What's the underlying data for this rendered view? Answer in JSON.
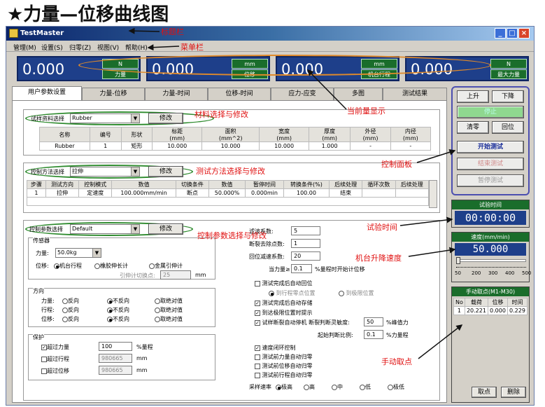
{
  "heading": "★力量—位移曲线图",
  "window": {
    "title": "TestMaster"
  },
  "menu": [
    "管理(M)",
    "设置(S)",
    "归零(Z)",
    "视图(V)",
    "帮助(H)"
  ],
  "readouts": [
    {
      "value": "0.000",
      "unit": "N",
      "label": "力量"
    },
    {
      "value": "0.000",
      "unit": "mm",
      "label": "位移"
    },
    {
      "value": "0.000",
      "unit": "mm",
      "label": "机台行程"
    },
    {
      "value": "0.000",
      "unit": "N",
      "label": "最大力量"
    }
  ],
  "tabs": [
    "用户参数设置",
    "力量-位移",
    "力量-时间",
    "位移-时间",
    "应力-应变",
    "多图",
    "测试结果"
  ],
  "material": {
    "label": "试样资料选择",
    "selected": "Rubber",
    "modify": "修改",
    "headers": [
      "名称",
      "编号",
      "形状",
      "标距\n(mm)",
      "面积\n(mm^2)",
      "宽度\n(mm)",
      "厚度\n(mm)",
      "外径\n(mm)",
      "内径\n(mm)"
    ],
    "row": [
      "Rubber",
      "1",
      "矩形",
      "10.000",
      "10.000",
      "10.000",
      "1.000",
      "-",
      "-"
    ]
  },
  "method": {
    "label": "控制方法选择",
    "selected": "拉伸",
    "modify": "修改",
    "headers": [
      "步骤",
      "测试方向",
      "控制模式",
      "数值",
      "切换条件",
      "数值",
      "暂停时间",
      "转换条件(%)",
      "后续处理",
      "循环次数",
      "后续处理"
    ],
    "row": [
      "1",
      "拉伸",
      "定速度",
      "100.000mm/min",
      "断点",
      "50.000%",
      "0.000min",
      "100.00",
      "结束",
      "",
      ""
    ]
  },
  "params": {
    "label": "控制参数选择",
    "selected": "Default",
    "modify": "修改",
    "sensor": {
      "title": "传感器",
      "force_label": "力量:",
      "force_value": "50.0kg",
      "disp_label": "位移:",
      "disp_options": [
        "机台行程",
        "橡胶伸长计",
        "金属引伸计"
      ],
      "switch_label": "引伸计切换点:",
      "switch_value": "25",
      "switch_unit": "mm"
    },
    "direction": {
      "title": "方向",
      "rows": [
        {
          "label": "力量:",
          "opts": [
            "反向",
            "不反向",
            "取绝对值"
          ]
        },
        {
          "label": "行程:",
          "opts": [
            "反向",
            "不反向",
            "取绝对值"
          ]
        },
        {
          "label": "位移:",
          "opts": [
            "反向",
            "不反向",
            "取绝对值"
          ]
        }
      ]
    },
    "protect": {
      "title": "保护",
      "rows": [
        {
          "label": "超过力量",
          "value": "100",
          "unit": "%量程"
        },
        {
          "label": "超过行程",
          "value": "980665",
          "unit": "mm"
        },
        {
          "label": "超过位移",
          "value": "980665",
          "unit": "mm"
        }
      ]
    },
    "right": {
      "filter_label": "滤波系数:",
      "filter_value": "5",
      "break_label": "断裂去除点数:",
      "break_value": "1",
      "return_label": "回位减速系数:",
      "return_value": "20",
      "force_ge_label": "当力量≥",
      "force_ge_value": "0.1",
      "force_ge_suffix": "%量程时开始计位移",
      "auto_return": "测试完成后自动回位",
      "to_zero": "到行程零点位置",
      "to_limit": "到极限位置",
      "auto_save": "测试完成后自动存储",
      "limit_prompt": "到达极限位置时提示",
      "break_stop": "试样断裂自动停机 断裂判断灵敏度:",
      "break_sens_value": "50",
      "break_sens_unit": "%峰值力",
      "break_start_label": "起始判断比例:",
      "break_start_value": "0.1",
      "break_start_unit": "%力量程",
      "speed_loop": "速度闭环控制",
      "pre_force_zero": "测试前力量自动归零",
      "pre_disp_zero": "测试前位移自动归零",
      "pre_travel_zero": "测试前行程自动归零",
      "rate_label": "采样速率",
      "rates": [
        "极高",
        "高",
        "中",
        "低",
        "极低"
      ]
    }
  },
  "control": {
    "up": "上升",
    "down": "下降",
    "stop": "停止",
    "clear": "清零",
    "return": "回位",
    "start": "开始测试",
    "end": "结束测试",
    "pause": "暂停测试"
  },
  "timer": {
    "title": "试验时间",
    "value": "00:00:00"
  },
  "speed": {
    "title": "速度(mm/min)",
    "value": "50.000",
    "ticks": [
      "50",
      "200",
      "300",
      "400",
      "500"
    ]
  },
  "manual": {
    "title": "手动取点(M1-M30)",
    "headers": [
      "No",
      "载荷",
      "位移",
      "时间"
    ],
    "row": [
      "1",
      "20.221",
      "0.000",
      "0.229"
    ],
    "take": "取点",
    "delete": "删除"
  },
  "annotations": {
    "title_bar": "标题栏",
    "menu_bar": "菜单栏",
    "current": "当前量显示",
    "material": "材料选择与修改",
    "method": "测试方法选择与修改",
    "params": "控制参数选择与修改",
    "panel": "控制面板",
    "time": "试验时间",
    "lift_speed": "机台升降速度",
    "manual": "手动取点"
  },
  "colors": {
    "accent_red": "#e01010",
    "lcd_blue": "#1e3f8a",
    "label_green": "#1a6d2b",
    "ellipse_green": "#2e8b2e"
  }
}
